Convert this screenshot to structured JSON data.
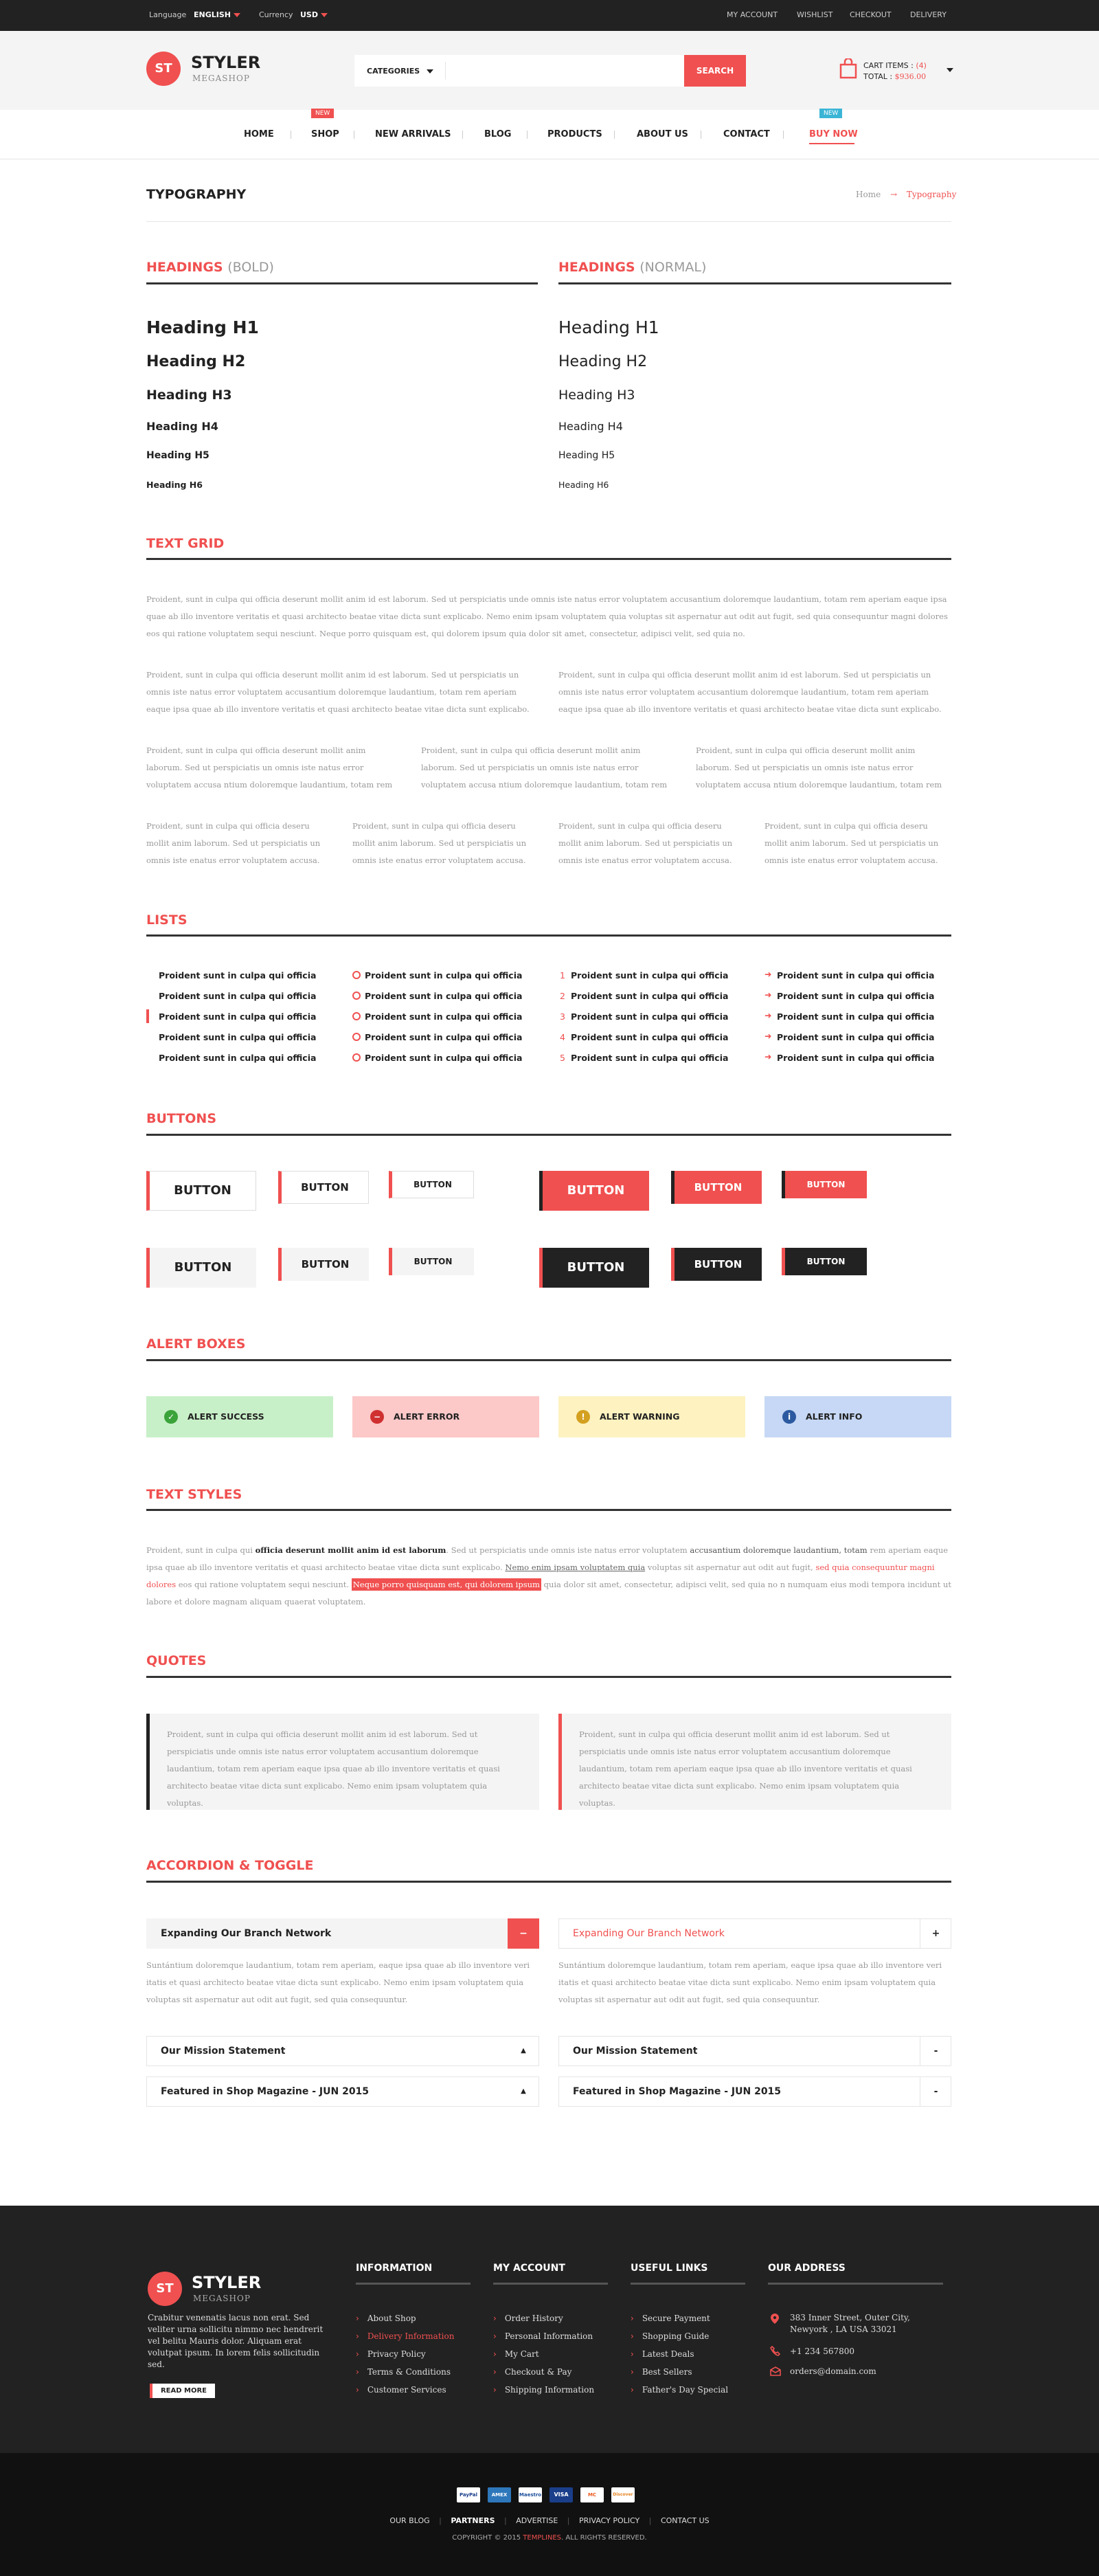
{
  "topbar": {
    "language_label": "Language",
    "language_value": "ENGLISH",
    "currency_label": "Currency",
    "currency_value": "USD",
    "links": [
      "MY ACCOUNT",
      "WISHLIST",
      "CHECKOUT",
      "DELIVERY"
    ]
  },
  "header": {
    "logo_mark": "ST",
    "logo_name": "STYLER",
    "logo_sub": "MEGASHOP",
    "categories_label": "CATEGORIES",
    "search_placeholder": "",
    "search_button": "SEARCH",
    "cart_items_label": "CART ITEMS :",
    "cart_items_count": "(4)",
    "cart_total_label": "TOTAL :",
    "cart_total_value": "$936.00"
  },
  "nav": {
    "items": [
      "HOME",
      "SHOP",
      "NEW ARRIVALS",
      "BLOG",
      "PRODUCTS",
      "ABOUT US",
      "CONTACT",
      "BUY NOW"
    ],
    "shop_badge": "NEW",
    "buynow_badge": "NEW"
  },
  "page": {
    "title": "TYPOGRAPHY",
    "breadcrumb_home": "Home",
    "breadcrumb_sep": "→",
    "breadcrumb_current": "Typography"
  },
  "headings": {
    "bold_title": "HEADINGS",
    "bold_suffix": "(BOLD)",
    "normal_title": "HEADINGS",
    "normal_suffix": "(NORMAL)",
    "items": [
      "Heading H1",
      "Heading H2",
      "Heading H3",
      "Heading H4",
      "Heading H5",
      "Heading H6"
    ]
  },
  "text_grid": {
    "title": "TEXT GRID",
    "full": "Proident, sunt in culpa qui officia deserunt mollit anim id est laborum. Sed ut perspiciatis unde omnis iste natus error voluptatem accusantium doloremque laudantium, totam rem aperiam eaque ipsa quae ab illo inventore veritatis et quasi architecto beatae vitae dicta sunt explicabo. Nemo enim ipsam voluptatem quia voluptas sit aspernatur aut odit aut fugit, sed quia consequuntur magni dolores eos qui ratione voluptatem sequi nesciunt. Neque porro quisquam est, qui dolorem ipsum quia dolor sit amet, consectetur, adipisci velit, sed quia no.",
    "half": "Proident, sunt in culpa qui officia deserunt mollit anim id est laborum. Sed ut perspiciatis un omnis iste natus error voluptatem accusantium doloremque laudantium, totam rem aperiam eaque ipsa quae ab illo inventore veritatis et quasi architecto beatae vitae dicta sunt explicabo.",
    "third": "Proident, sunt in culpa qui officia deserunt mollit anim laborum. Sed ut perspiciatis un omnis iste natus error voluptatem accusa ntium doloremque laudantium, totam rem aperiam.",
    "quarter": "Proident, sunt in culpa qui officia deseru mollit anim laborum. Sed ut perspiciatis un omnis iste enatus error voluptatem accusa."
  },
  "lists": {
    "title": "LISTS",
    "item": "Proident sunt in culpa qui officia",
    "numbers": [
      "1",
      "2",
      "3",
      "4",
      "5"
    ]
  },
  "buttons": {
    "title": "BUTTONS",
    "label": "BUTTON"
  },
  "alerts": {
    "title": "ALERT BOXES",
    "items": [
      {
        "label": "ALERT SUCCESS",
        "bg": "#c8f0c8",
        "icon": "✓",
        "icon_color": "#3aa33a",
        "icon_name": "check-icon"
      },
      {
        "label": "ALERT ERROR",
        "bg": "#fcc8c8",
        "icon": "−",
        "icon_color": "#d03030",
        "icon_name": "minus-icon"
      },
      {
        "label": "ALERT WARNING",
        "bg": "#fdf2c0",
        "icon": "!",
        "icon_color": "#d4a020",
        "icon_name": "warning-icon"
      },
      {
        "label": "ALERT INFO",
        "bg": "#c6d8f5",
        "icon": "i",
        "icon_color": "#2c5aa0",
        "icon_name": "info-icon"
      }
    ]
  },
  "text_styles": {
    "title": "TEXT STYLES",
    "p1": "Proident, sunt in culpa qui ",
    "bold1": "officia deserunt mollit anim id est laborum",
    "p2": ". Sed ut perspiciatis unde omnis iste natus error voluptatem ",
    "mid1": "accusantium doloremque laudantium, totam",
    "p3": " rem aperiam eaque ipsa quae ab illo inventore veritatis et quasi architecto beatae vitae dicta sunt explicabo. ",
    "under1": "Nemo enim ipsam voluptatem quia",
    "p4": " voluptas sit aspernatur aut odit aut fugit, ",
    "red1": "sed quia consequuntur magni dolores",
    "p5": " eos qui ratione voluptatem sequi nesciunt. ",
    "hl1": "Neque porro quisquam est, qui dolorem ipsum",
    "p6": " quia dolor sit amet, consectetur, adipisci velit, sed quia no n numquam eius modi tempora incidunt ut labore et dolore magnam aliquam quaerat voluptatem."
  },
  "quotes": {
    "title": "QUOTES",
    "text": "Proident, sunt in culpa qui officia deserunt mollit anim id est laborum. Sed ut perspiciatis unde omnis iste natus error voluptatem accusantium doloremque laudantium, totam rem aperiam eaque ipsa quae ab illo inventore veritatis et quasi architecto beatae vitae dicta sunt explicabo. Nemo enim ipsam voluptatem quia voluptas."
  },
  "accordion": {
    "title": "ACCORDION & TOGGLE",
    "first": "Expanding Our Branch Network",
    "body": "Suntántium doloremque laudantium, totam rem aperiam, eaque ipsa quae ab illo inventore veri itatis et quasi architecto beatae vitae dicta sunt explicabo. Nemo enim ipsam voluptatem quia voluptas sit aspernatur aut odit aut fugit, sed quia consequuntur.",
    "second": "Our Mission Statement",
    "third": "Featured in Shop Magazine - JUN 2015",
    "minus": "−",
    "plus": "+",
    "arrow_up": "▲",
    "dash": "-"
  },
  "footer": {
    "logo_mark": "ST",
    "logo_name": "STYLER",
    "logo_sub": "MEGASHOP",
    "about": "Crabitur venenatis lacus non erat. Sed veliter urna sollicitu nimmo nec hendrerit vel belitu Mauris dolor. Aliquam erat volutpat ipsum. In lorem felis sollicitudin sed.",
    "read_more": "READ MORE",
    "info_title": "INFORMATION",
    "info_links": [
      "About Shop",
      "Delivery Information",
      "Privacy Policy",
      "Terms & Conditions",
      "Customer Services"
    ],
    "account_title": "MY ACCOUNT",
    "account_links": [
      "Order History",
      "Personal Information",
      "My Cart",
      "Checkout & Pay",
      "Shipping Information"
    ],
    "useful_title": "USEFUL LINKS",
    "useful_links": [
      "Secure Payment",
      "Shopping Guide",
      "Latest Deals",
      "Best Sellers",
      "Father's Day Special"
    ],
    "address_title": "OUR ADDRESS",
    "address": "383 Inner Street, Outer City, Newyork , LA USA 33021",
    "phone": "+1 234 567800",
    "email": "orders@domain.com"
  },
  "bottom": {
    "payments": [
      "PayPal",
      "AMEX",
      "Maestro",
      "VISA",
      "MC",
      "Discover"
    ],
    "links": [
      "OUR BLOG",
      "PARTNERS",
      "ADVERTISE",
      "PRIVACY POLICY",
      "CONTACT US"
    ],
    "copyright_pre": "COPYRIGHT © 2015",
    "copyright_brand": "TEMPLINES",
    "copyright_post": ". ALL RIGHTS RESERVED."
  }
}
